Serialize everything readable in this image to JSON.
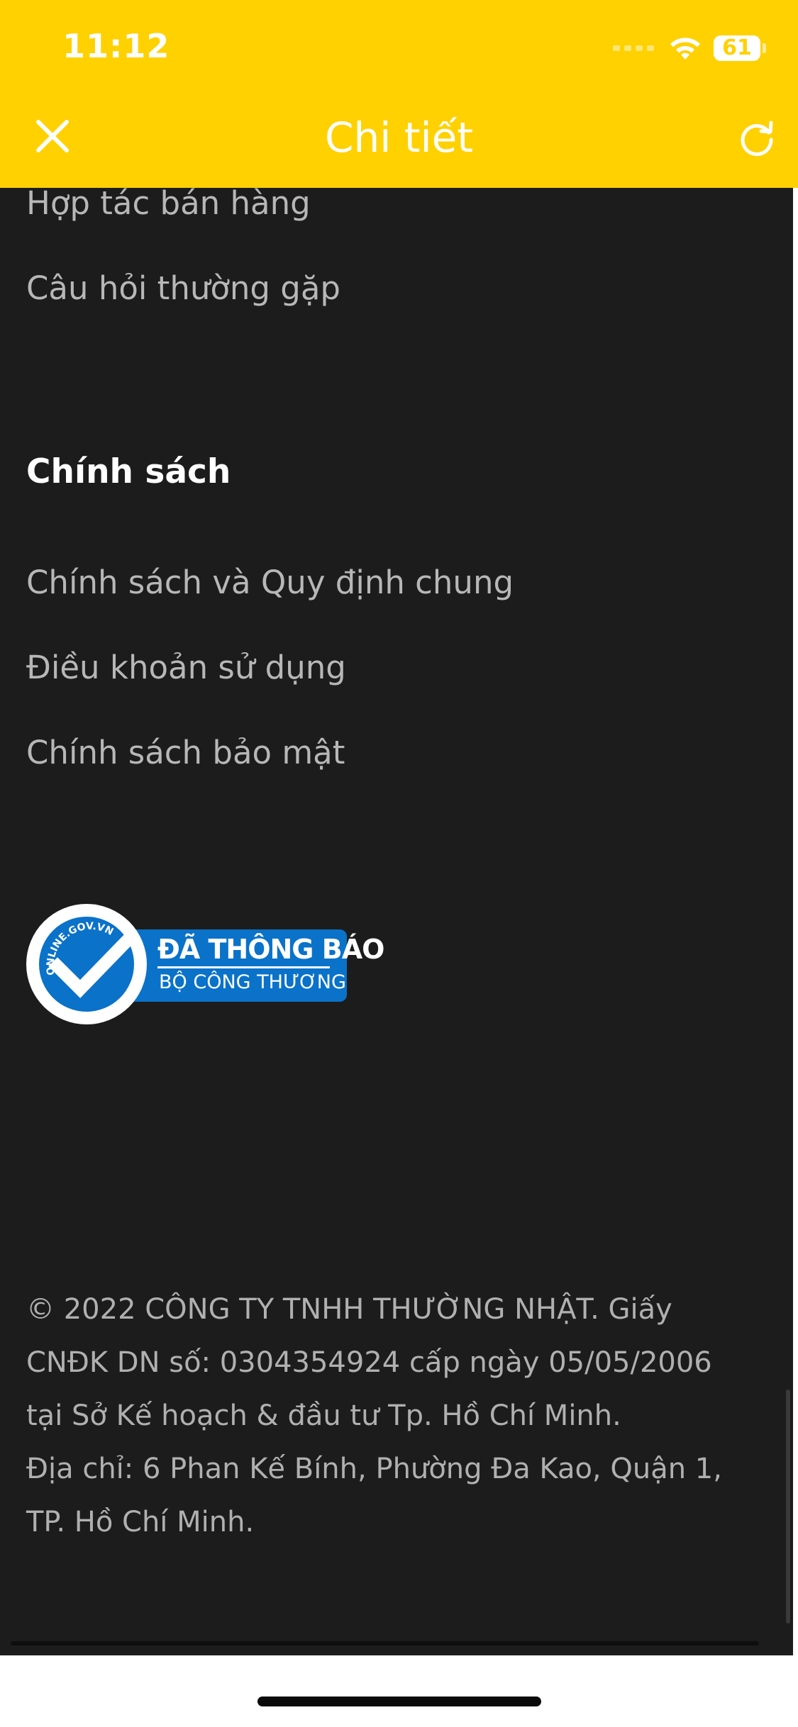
{
  "status_bar": {
    "time": "11:12",
    "battery": "61"
  },
  "header": {
    "title": "Chi tiết",
    "close_icon": "close-icon",
    "reload_icon": "reload-icon",
    "background": "#FFD100"
  },
  "links_top": [
    "Hợp tác bán hàng",
    "Câu hỏi thường gặp"
  ],
  "policy": {
    "title": "Chính sách",
    "items": [
      "Chính sách và Quy định chung",
      "Điều khoản sử dụng",
      "Chính sách bảo mật"
    ]
  },
  "badge": {
    "arc_text": "ONLINE.GOV.VN",
    "line1": "ĐÃ THÔNG BÁO",
    "line2": "BỘ CÔNG THƯƠNG",
    "color": "#0A72C9"
  },
  "footer": {
    "line1": "© 2022 CÔNG TY TNHH THƯỜNG NHẬT. Giấy CNĐK DN số: 0304354924 cấp ngày 05/05/2006 tại Sở Kế hoạch & đầu tư Tp. Hồ Chí Minh.",
    "line2": "Địa chỉ: 6 Phan Kế Bính, Phường Đa Kao, Quận 1, TP. Hồ Chí Minh."
  }
}
